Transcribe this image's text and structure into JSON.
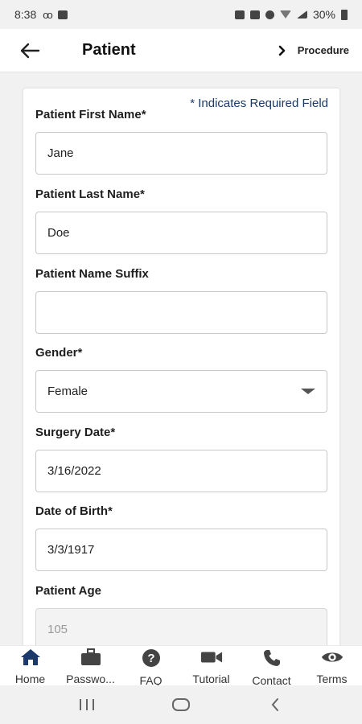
{
  "status_bar": {
    "time": "8:38",
    "battery": "30%"
  },
  "app_bar": {
    "title": "Patient",
    "next_label": "Procedure"
  },
  "form": {
    "required_note": "* Indicates Required Field",
    "fields": [
      {
        "label": "Patient First Name*",
        "value": "Jane",
        "type": "text"
      },
      {
        "label": "Patient Last Name*",
        "value": "Doe",
        "type": "text"
      },
      {
        "label": "Patient Name Suffix",
        "value": "",
        "type": "text"
      },
      {
        "label": "Gender*",
        "value": "Female",
        "type": "select"
      },
      {
        "label": "Surgery Date*",
        "value": "3/16/2022",
        "type": "date"
      },
      {
        "label": "Date of Birth*",
        "value": "3/3/1917",
        "type": "date"
      },
      {
        "label": "Patient Age",
        "value": "105",
        "type": "readonly"
      }
    ]
  },
  "bottom_nav": {
    "items": [
      {
        "label": "Home",
        "icon": "home-icon",
        "active": true
      },
      {
        "label": "Passwo...",
        "icon": "briefcase-icon",
        "active": false
      },
      {
        "label": "FAQ",
        "icon": "help-icon",
        "active": false
      },
      {
        "label": "Tutorial",
        "icon": "video-camera-icon",
        "active": false
      },
      {
        "label": "Contact",
        "icon": "phone-icon",
        "active": false
      },
      {
        "label": "Terms",
        "icon": "eye-icon",
        "active": false
      }
    ]
  },
  "colors": {
    "accent": "#1b3a6b",
    "active_nav": "#1b3a6b",
    "icon": "#444444"
  }
}
